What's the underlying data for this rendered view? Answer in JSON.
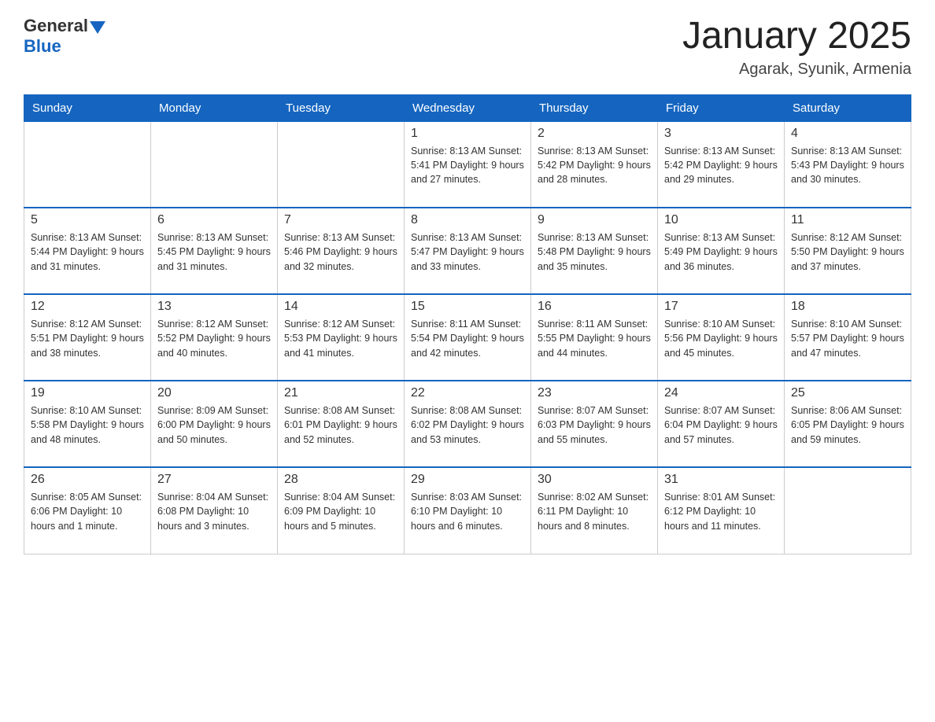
{
  "header": {
    "logo_general": "General",
    "logo_blue": "Blue",
    "title": "January 2025",
    "subtitle": "Agarak, Syunik, Armenia"
  },
  "days_of_week": [
    "Sunday",
    "Monday",
    "Tuesday",
    "Wednesday",
    "Thursday",
    "Friday",
    "Saturday"
  ],
  "weeks": [
    [
      {
        "day": "",
        "info": ""
      },
      {
        "day": "",
        "info": ""
      },
      {
        "day": "",
        "info": ""
      },
      {
        "day": "1",
        "info": "Sunrise: 8:13 AM\nSunset: 5:41 PM\nDaylight: 9 hours and 27 minutes."
      },
      {
        "day": "2",
        "info": "Sunrise: 8:13 AM\nSunset: 5:42 PM\nDaylight: 9 hours and 28 minutes."
      },
      {
        "day": "3",
        "info": "Sunrise: 8:13 AM\nSunset: 5:42 PM\nDaylight: 9 hours and 29 minutes."
      },
      {
        "day": "4",
        "info": "Sunrise: 8:13 AM\nSunset: 5:43 PM\nDaylight: 9 hours and 30 minutes."
      }
    ],
    [
      {
        "day": "5",
        "info": "Sunrise: 8:13 AM\nSunset: 5:44 PM\nDaylight: 9 hours and 31 minutes."
      },
      {
        "day": "6",
        "info": "Sunrise: 8:13 AM\nSunset: 5:45 PM\nDaylight: 9 hours and 31 minutes."
      },
      {
        "day": "7",
        "info": "Sunrise: 8:13 AM\nSunset: 5:46 PM\nDaylight: 9 hours and 32 minutes."
      },
      {
        "day": "8",
        "info": "Sunrise: 8:13 AM\nSunset: 5:47 PM\nDaylight: 9 hours and 33 minutes."
      },
      {
        "day": "9",
        "info": "Sunrise: 8:13 AM\nSunset: 5:48 PM\nDaylight: 9 hours and 35 minutes."
      },
      {
        "day": "10",
        "info": "Sunrise: 8:13 AM\nSunset: 5:49 PM\nDaylight: 9 hours and 36 minutes."
      },
      {
        "day": "11",
        "info": "Sunrise: 8:12 AM\nSunset: 5:50 PM\nDaylight: 9 hours and 37 minutes."
      }
    ],
    [
      {
        "day": "12",
        "info": "Sunrise: 8:12 AM\nSunset: 5:51 PM\nDaylight: 9 hours and 38 minutes."
      },
      {
        "day": "13",
        "info": "Sunrise: 8:12 AM\nSunset: 5:52 PM\nDaylight: 9 hours and 40 minutes."
      },
      {
        "day": "14",
        "info": "Sunrise: 8:12 AM\nSunset: 5:53 PM\nDaylight: 9 hours and 41 minutes."
      },
      {
        "day": "15",
        "info": "Sunrise: 8:11 AM\nSunset: 5:54 PM\nDaylight: 9 hours and 42 minutes."
      },
      {
        "day": "16",
        "info": "Sunrise: 8:11 AM\nSunset: 5:55 PM\nDaylight: 9 hours and 44 minutes."
      },
      {
        "day": "17",
        "info": "Sunrise: 8:10 AM\nSunset: 5:56 PM\nDaylight: 9 hours and 45 minutes."
      },
      {
        "day": "18",
        "info": "Sunrise: 8:10 AM\nSunset: 5:57 PM\nDaylight: 9 hours and 47 minutes."
      }
    ],
    [
      {
        "day": "19",
        "info": "Sunrise: 8:10 AM\nSunset: 5:58 PM\nDaylight: 9 hours and 48 minutes."
      },
      {
        "day": "20",
        "info": "Sunrise: 8:09 AM\nSunset: 6:00 PM\nDaylight: 9 hours and 50 minutes."
      },
      {
        "day": "21",
        "info": "Sunrise: 8:08 AM\nSunset: 6:01 PM\nDaylight: 9 hours and 52 minutes."
      },
      {
        "day": "22",
        "info": "Sunrise: 8:08 AM\nSunset: 6:02 PM\nDaylight: 9 hours and 53 minutes."
      },
      {
        "day": "23",
        "info": "Sunrise: 8:07 AM\nSunset: 6:03 PM\nDaylight: 9 hours and 55 minutes."
      },
      {
        "day": "24",
        "info": "Sunrise: 8:07 AM\nSunset: 6:04 PM\nDaylight: 9 hours and 57 minutes."
      },
      {
        "day": "25",
        "info": "Sunrise: 8:06 AM\nSunset: 6:05 PM\nDaylight: 9 hours and 59 minutes."
      }
    ],
    [
      {
        "day": "26",
        "info": "Sunrise: 8:05 AM\nSunset: 6:06 PM\nDaylight: 10 hours and 1 minute."
      },
      {
        "day": "27",
        "info": "Sunrise: 8:04 AM\nSunset: 6:08 PM\nDaylight: 10 hours and 3 minutes."
      },
      {
        "day": "28",
        "info": "Sunrise: 8:04 AM\nSunset: 6:09 PM\nDaylight: 10 hours and 5 minutes."
      },
      {
        "day": "29",
        "info": "Sunrise: 8:03 AM\nSunset: 6:10 PM\nDaylight: 10 hours and 6 minutes."
      },
      {
        "day": "30",
        "info": "Sunrise: 8:02 AM\nSunset: 6:11 PM\nDaylight: 10 hours and 8 minutes."
      },
      {
        "day": "31",
        "info": "Sunrise: 8:01 AM\nSunset: 6:12 PM\nDaylight: 10 hours and 11 minutes."
      },
      {
        "day": "",
        "info": ""
      }
    ]
  ]
}
